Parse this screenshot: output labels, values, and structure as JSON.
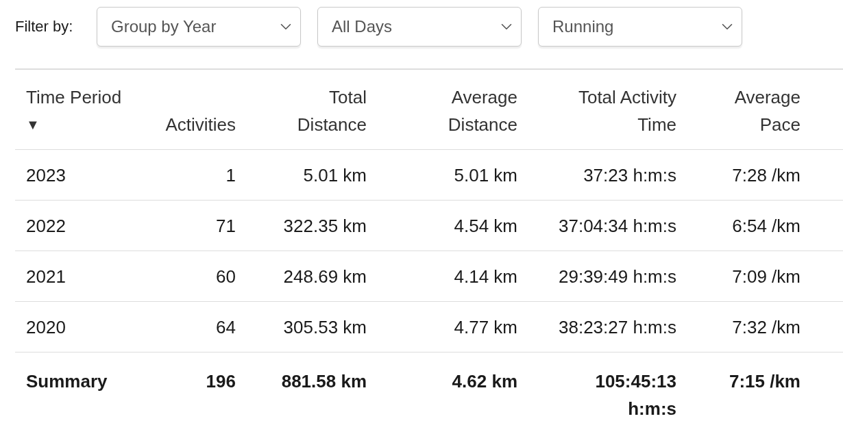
{
  "filter": {
    "label": "Filter by:",
    "dropdowns": [
      {
        "value": "Group by Year"
      },
      {
        "value": "All Days"
      },
      {
        "value": "Running"
      }
    ]
  },
  "table": {
    "columns": [
      {
        "label": "Time Period",
        "sort": "▼",
        "kind": "text"
      },
      {
        "label": "Activities",
        "kind": "number"
      },
      {
        "label": "Total Distance",
        "kind": "number"
      },
      {
        "label": "Average Distance",
        "kind": "number"
      },
      {
        "label": "Total Activity Time",
        "kind": "number"
      },
      {
        "label": "Average Pace",
        "kind": "number"
      }
    ],
    "rows": [
      [
        "2023",
        "1",
        "5.01 km",
        "5.01 km",
        "37:23 h:m:s",
        "7:28 /km"
      ],
      [
        "2022",
        "71",
        "322.35 km",
        "4.54 km",
        "37:04:34 h:m:s",
        "6:54 /km"
      ],
      [
        "2021",
        "60",
        "248.69 km",
        "4.14 km",
        "29:39:49 h:m:s",
        "7:09 /km"
      ],
      [
        "2020",
        "64",
        "305.53 km",
        "4.77 km",
        "38:23:27 h:m:s",
        "7:32 /km"
      ]
    ],
    "summary": [
      "Summary",
      "196",
      "881.58 km",
      "4.62 km",
      "105:45:13 h:m:s",
      "7:15 /km"
    ]
  }
}
